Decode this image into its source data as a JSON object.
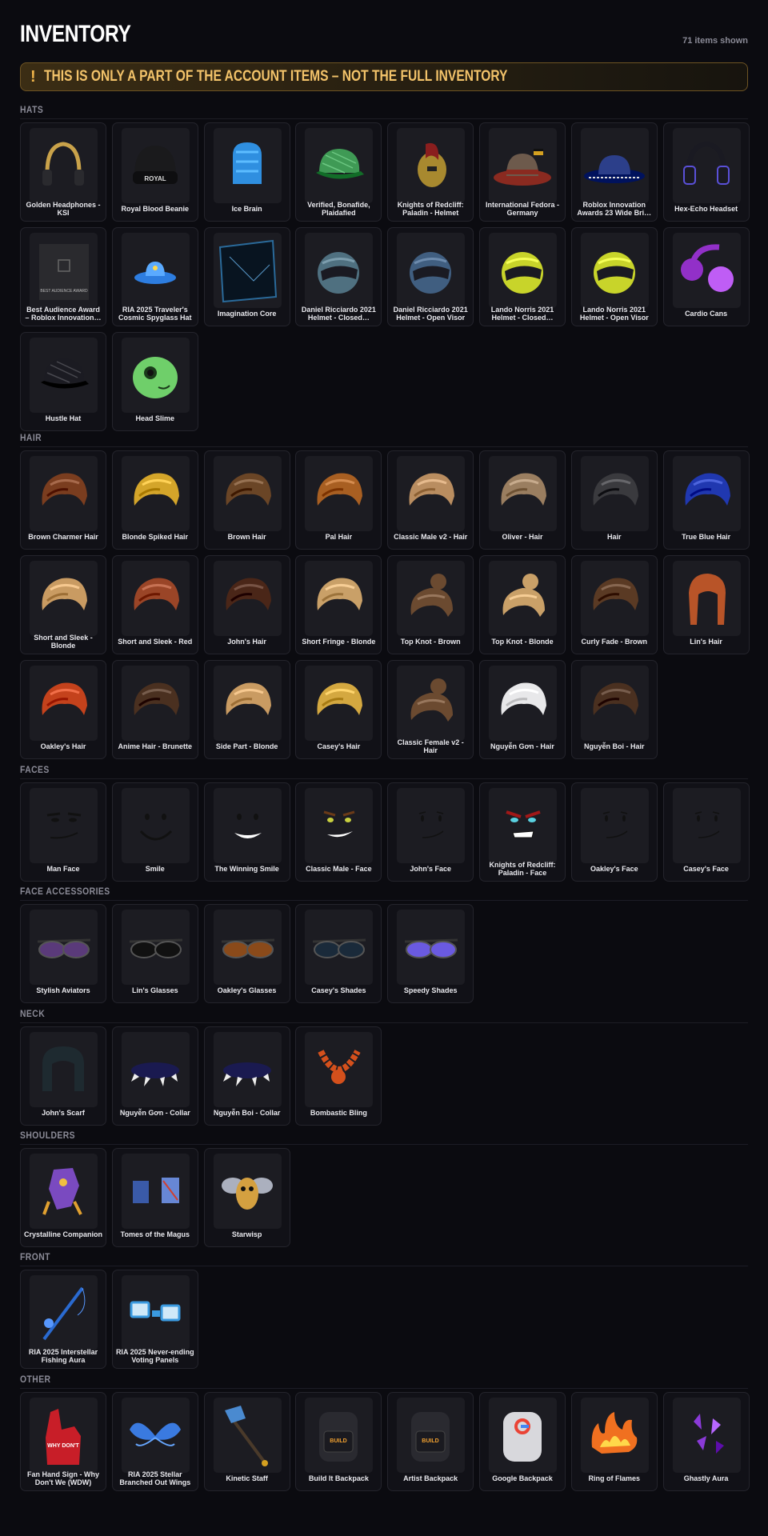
{
  "header": {
    "title": "INVENTORY",
    "count_text": "71 items shown",
    "notice_icon": "!",
    "notice_text": "THIS IS ONLY A PART OF THE ACCOUNT ITEMS – NOT THE FULL INVENTORY",
    "notice_color": "#f3c36a"
  },
  "sections": [
    {
      "title": "HATS",
      "items": [
        {
          "name": "Golden Headphones - KSI",
          "icon": "headphones",
          "color": "#c9a24a"
        },
        {
          "name": "Royal Blood Beanie",
          "icon": "beanie",
          "color": "#1a1a1c"
        },
        {
          "name": "Ice Brain",
          "icon": "ice-brain",
          "color": "#2f8fe0"
        },
        {
          "name": "Verified, Bonafide, Plaidafied",
          "icon": "cap",
          "color": "#3f9a55"
        },
        {
          "name": "Knights of Redcliff: Paladin - Helmet",
          "icon": "knight-helmet",
          "color": "#a8892f"
        },
        {
          "name": "International Fedora - Germany",
          "icon": "fedora",
          "color": "#6d5a4c"
        },
        {
          "name": "Roblox Innovation Awards 23 Wide Bri…",
          "icon": "wide-brim-hat",
          "color": "#2c3f8a"
        },
        {
          "name": "Hex-Echo Headset",
          "icon": "headset",
          "color": "#5a50d8"
        },
        {
          "name": "Best Audience Award – Roblox Innovation…",
          "icon": "award-box",
          "color": "#2a2a2e"
        },
        {
          "name": "RIA 2025 Traveler's Cosmic Spyglass Hat",
          "icon": "cosmic-hat",
          "color": "#2d7de0"
        },
        {
          "name": "Imagination Core",
          "icon": "cube",
          "color": "#2a6a9a"
        },
        {
          "name": "Daniel Ricciardo 2021 Helmet - Closed…",
          "icon": "racing-helmet",
          "color": "#4f7080"
        },
        {
          "name": "Daniel Ricciardo 2021 Helmet - Open Visor",
          "icon": "racing-helmet",
          "color": "#405e80"
        },
        {
          "name": "Lando Norris 2021 Helmet - Closed…",
          "icon": "racing-helmet",
          "color": "#c8d42a"
        },
        {
          "name": "Lando Norris 2021 Helmet - Open Visor",
          "icon": "racing-helmet",
          "color": "#c8d42a"
        },
        {
          "name": "Cardio Cans",
          "icon": "earmuffs",
          "color": "#9230c8"
        },
        {
          "name": "Hustle Hat",
          "icon": "cap",
          "color": "#1b1b22"
        },
        {
          "name": "Head Slime",
          "icon": "slime",
          "color": "#6fcf6a"
        }
      ]
    },
    {
      "title": "HAIR",
      "items": [
        {
          "name": "Brown Charmer Hair",
          "icon": "hair",
          "color": "#7a3d1f"
        },
        {
          "name": "Blonde Spiked Hair",
          "icon": "hair",
          "color": "#d4a52a"
        },
        {
          "name": "Brown Hair",
          "icon": "hair",
          "color": "#6a4526"
        },
        {
          "name": "Pal Hair",
          "icon": "hair",
          "color": "#a85f22"
        },
        {
          "name": "Classic Male v2 - Hair",
          "icon": "hair",
          "color": "#b98d60"
        },
        {
          "name": "Oliver - Hair",
          "icon": "hair",
          "color": "#9a7e60"
        },
        {
          "name": "Hair",
          "icon": "hair",
          "color": "#3a3a3e"
        },
        {
          "name": "True Blue Hair",
          "icon": "hair",
          "color": "#2038b0"
        },
        {
          "name": "Short and Sleek - Blonde",
          "icon": "hair",
          "color": "#c99b62"
        },
        {
          "name": "Short and Sleek - Red",
          "icon": "hair",
          "color": "#9a4527"
        },
        {
          "name": "John's Hair",
          "icon": "hair",
          "color": "#4a2618"
        },
        {
          "name": "Short Fringe - Blonde",
          "icon": "hair",
          "color": "#c9a068"
        },
        {
          "name": "Top Knot - Brown",
          "icon": "hair-bun",
          "color": "#6b4a30"
        },
        {
          "name": "Top Knot - Blonde",
          "icon": "hair-bun",
          "color": "#c9a068"
        },
        {
          "name": "Curly Fade - Brown",
          "icon": "hair",
          "color": "#5a3a24"
        },
        {
          "name": "Lin's Hair",
          "icon": "hair-long",
          "color": "#b85428"
        },
        {
          "name": "Oakley's Hair",
          "icon": "hair",
          "color": "#c4421c"
        },
        {
          "name": "Anime Hair - Brunette",
          "icon": "hair",
          "color": "#4a3020"
        },
        {
          "name": "Side Part - Blonde",
          "icon": "hair",
          "color": "#c99b62"
        },
        {
          "name": "Casey's Hair",
          "icon": "hair",
          "color": "#d4a840"
        },
        {
          "name": "Classic Female v2 - Hair",
          "icon": "hair-bun",
          "color": "#6b4a30"
        },
        {
          "name": "Nguyễn Gơn - Hair",
          "icon": "hair",
          "color": "#e8e8ea"
        },
        {
          "name": "Nguyễn Boi - Hair",
          "icon": "hair",
          "color": "#4a3020"
        }
      ]
    },
    {
      "title": "FACES",
      "items": [
        {
          "name": "Man Face",
          "icon": "face-man",
          "color": "#111111"
        },
        {
          "name": "Smile",
          "icon": "face-smile",
          "color": "#111111"
        },
        {
          "name": "The Winning Smile",
          "icon": "face-winning",
          "color": "#111111"
        },
        {
          "name": "Classic Male - Face",
          "icon": "face-classic",
          "color": "#111111"
        },
        {
          "name": "John's Face",
          "icon": "face-smirk",
          "color": "#111111"
        },
        {
          "name": "Knights of Redcliff: Paladin - Face",
          "icon": "face-paladin",
          "color": "#111111"
        },
        {
          "name": "Oakley's Face",
          "icon": "face-smirk",
          "color": "#111111"
        },
        {
          "name": "Casey's Face",
          "icon": "face-smirk",
          "color": "#111111"
        }
      ]
    },
    {
      "title": "FACE ACCESSORIES",
      "items": [
        {
          "name": "Stylish Aviators",
          "icon": "glasses",
          "color": "#5a3a7a"
        },
        {
          "name": "Lin's Glasses",
          "icon": "glasses",
          "color": "#111111"
        },
        {
          "name": "Oakley's Glasses",
          "icon": "glasses",
          "color": "#8a4a1a"
        },
        {
          "name": "Casey's Shades",
          "icon": "glasses",
          "color": "#1a2a3a"
        },
        {
          "name": "Speedy Shades",
          "icon": "glasses",
          "color": "#6a5ae0"
        }
      ]
    },
    {
      "title": "NECK",
      "items": [
        {
          "name": "John's Scarf",
          "icon": "scarf",
          "color": "#1e2a30"
        },
        {
          "name": "Nguyễn Gơn - Collar",
          "icon": "collar",
          "color": "#1a1a50"
        },
        {
          "name": "Nguyễn Boi - Collar",
          "icon": "collar",
          "color": "#1a1a50"
        },
        {
          "name": "Bombastic Bling",
          "icon": "necklace",
          "color": "#d4501c"
        }
      ]
    },
    {
      "title": "SHOULDERS",
      "items": [
        {
          "name": "Crystalline Companion",
          "icon": "creature",
          "color": "#7a4ac0"
        },
        {
          "name": "Tomes of the Magus",
          "icon": "books",
          "color": "#3a5aa8"
        },
        {
          "name": "Starwisp",
          "icon": "bee",
          "color": "#d4a040"
        }
      ]
    },
    {
      "title": "FRONT",
      "items": [
        {
          "name": "RIA 2025 Interstellar Fishing Aura",
          "icon": "fishing-rod",
          "color": "#2a6ad0"
        },
        {
          "name": "RIA 2025 Never-ending Voting Panels",
          "icon": "panels",
          "color": "#3a9ae0"
        }
      ]
    },
    {
      "title": "OTHER",
      "items": [
        {
          "name": "Fan Hand Sign - Why Don't We (WDW)",
          "icon": "foam-hand",
          "color": "#c81e28"
        },
        {
          "name": "RIA 2025 Stellar Branched Out Wings",
          "icon": "wings",
          "color": "#3a7ae0"
        },
        {
          "name": "Kinetic Staff",
          "icon": "staff",
          "color": "#4a8ad0"
        },
        {
          "name": "Build It Backpack",
          "icon": "backpack",
          "color": "#2a2a30"
        },
        {
          "name": "Artist Backpack",
          "icon": "backpack",
          "color": "#2a2a30"
        },
        {
          "name": "Google Backpack",
          "icon": "backpack-google",
          "color": "#d8d8dc"
        },
        {
          "name": "Ring of Flames",
          "icon": "flames",
          "color": "#f07020"
        },
        {
          "name": "Ghastly Aura",
          "icon": "aura",
          "color": "#8a3ad8"
        }
      ]
    }
  ]
}
